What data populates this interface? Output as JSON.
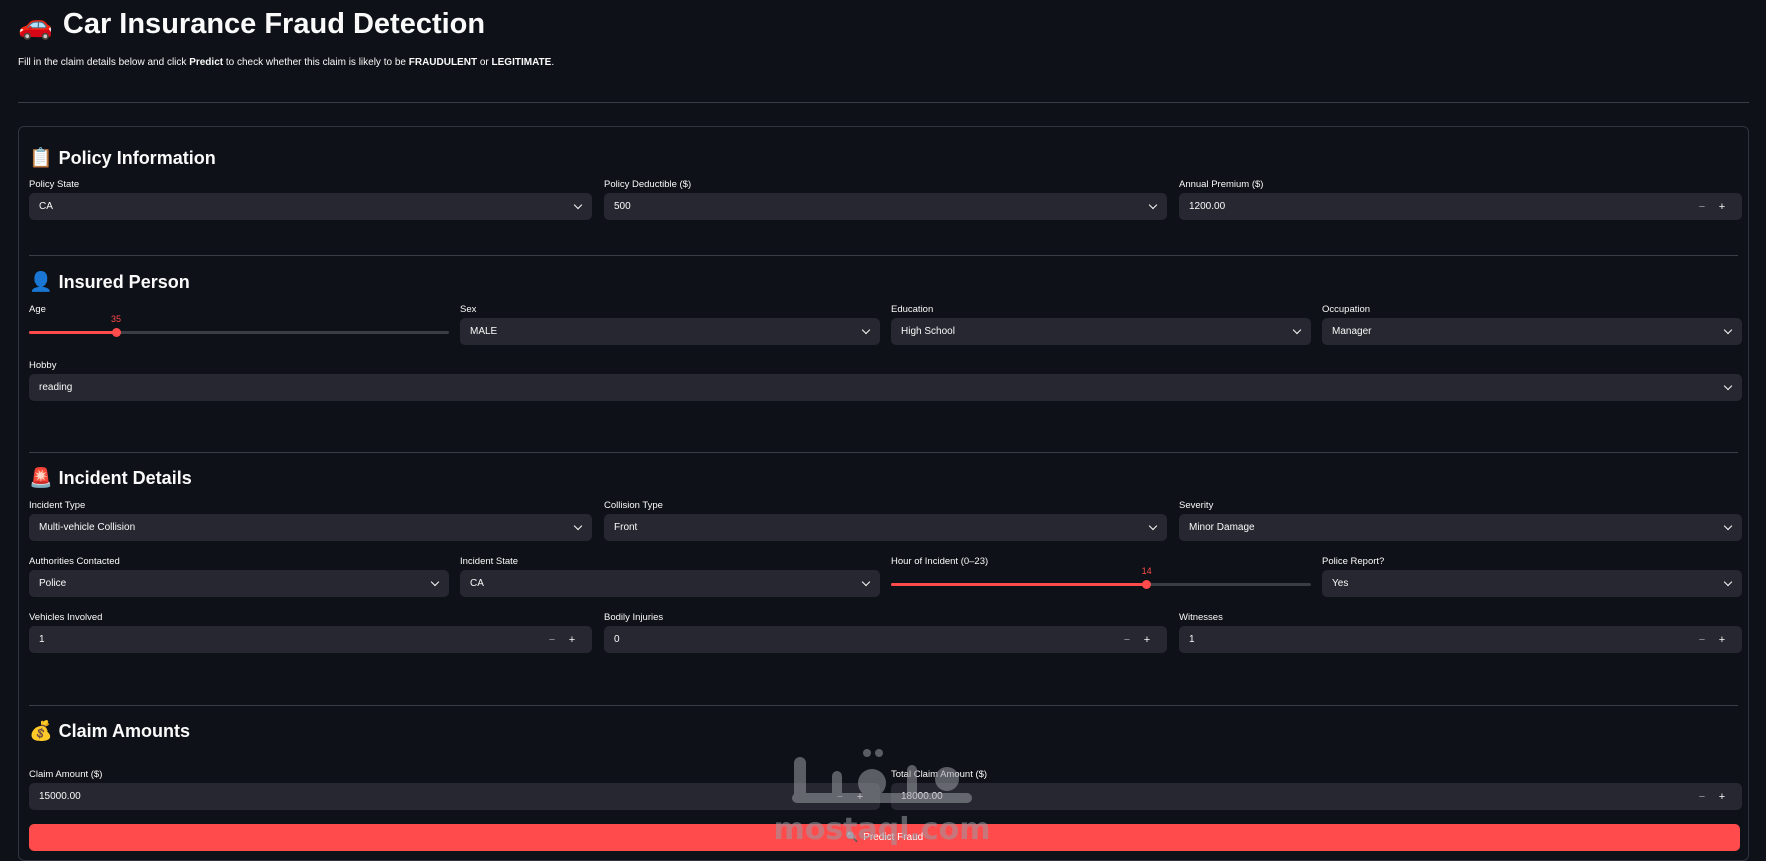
{
  "header": {
    "icon": "car-icon",
    "emoji": "🚗",
    "title": "Car Insurance Fraud Detection",
    "intro": {
      "part1": "Fill in the claim details below and click ",
      "strong1": "Predict",
      "part2": " to check whether this claim is likely to be ",
      "strong2": "FRAUDULENT",
      "part3": " or ",
      "strong3": "LEGITIMATE",
      "part4": "."
    }
  },
  "sections": {
    "policy": {
      "emoji": "📋",
      "icon": "clipboard-icon",
      "title": "Policy Information"
    },
    "insured": {
      "emoji": "👤",
      "icon": "person-icon",
      "title": "Insured Person"
    },
    "incident": {
      "emoji": "🚨",
      "icon": "siren-icon",
      "title": "Incident Details"
    },
    "claim": {
      "emoji": "💰",
      "icon": "money-bag-icon",
      "title": "Claim Amounts"
    }
  },
  "policy": {
    "state": {
      "label": "Policy State",
      "value": "CA"
    },
    "deductible": {
      "label": "Policy Deductible ($)",
      "value": "500"
    },
    "premium": {
      "label": "Annual Premium ($)",
      "value": "1200.00"
    }
  },
  "insured": {
    "age": {
      "label": "Age",
      "value": 35,
      "min": 18,
      "max": 100
    },
    "sex": {
      "label": "Sex",
      "value": "MALE"
    },
    "education": {
      "label": "Education",
      "value": "High School"
    },
    "occupation": {
      "label": "Occupation",
      "value": "Manager"
    },
    "hobby": {
      "label": "Hobby",
      "value": "reading"
    }
  },
  "incident": {
    "type": {
      "label": "Incident Type",
      "value": "Multi-vehicle Collision"
    },
    "collision": {
      "label": "Collision Type",
      "value": "Front"
    },
    "severity": {
      "label": "Severity",
      "value": "Minor Damage"
    },
    "authorities": {
      "label": "Authorities Contacted",
      "value": "Police"
    },
    "state": {
      "label": "Incident State",
      "value": "CA"
    },
    "hour": {
      "label": "Hour of Incident (0–23)",
      "value": 14,
      "min": 0,
      "max": 23
    },
    "police_report": {
      "label": "Police Report?",
      "value": "Yes"
    },
    "vehicles": {
      "label": "Vehicles Involved",
      "value": "1"
    },
    "injuries": {
      "label": "Bodily Injuries",
      "value": "0"
    },
    "witnesses": {
      "label": "Witnesses",
      "value": "1"
    }
  },
  "claim": {
    "amount": {
      "label": "Claim Amount ($)",
      "value": "15000.00"
    },
    "total": {
      "label": "Total Claim Amount ($)",
      "value": "18000.00"
    }
  },
  "stepper": {
    "minus": "−",
    "plus": "+"
  },
  "predict": {
    "icon": "magnifier-icon",
    "emoji": "🔍",
    "label": "Predict Fraud"
  },
  "watermark": {
    "arabic": "مستقل",
    "latin": "mostaql.com"
  },
  "colors": {
    "background": "#0e1117",
    "input": "#262730",
    "accent": "#ff4b4b",
    "text": "#fafafa"
  }
}
